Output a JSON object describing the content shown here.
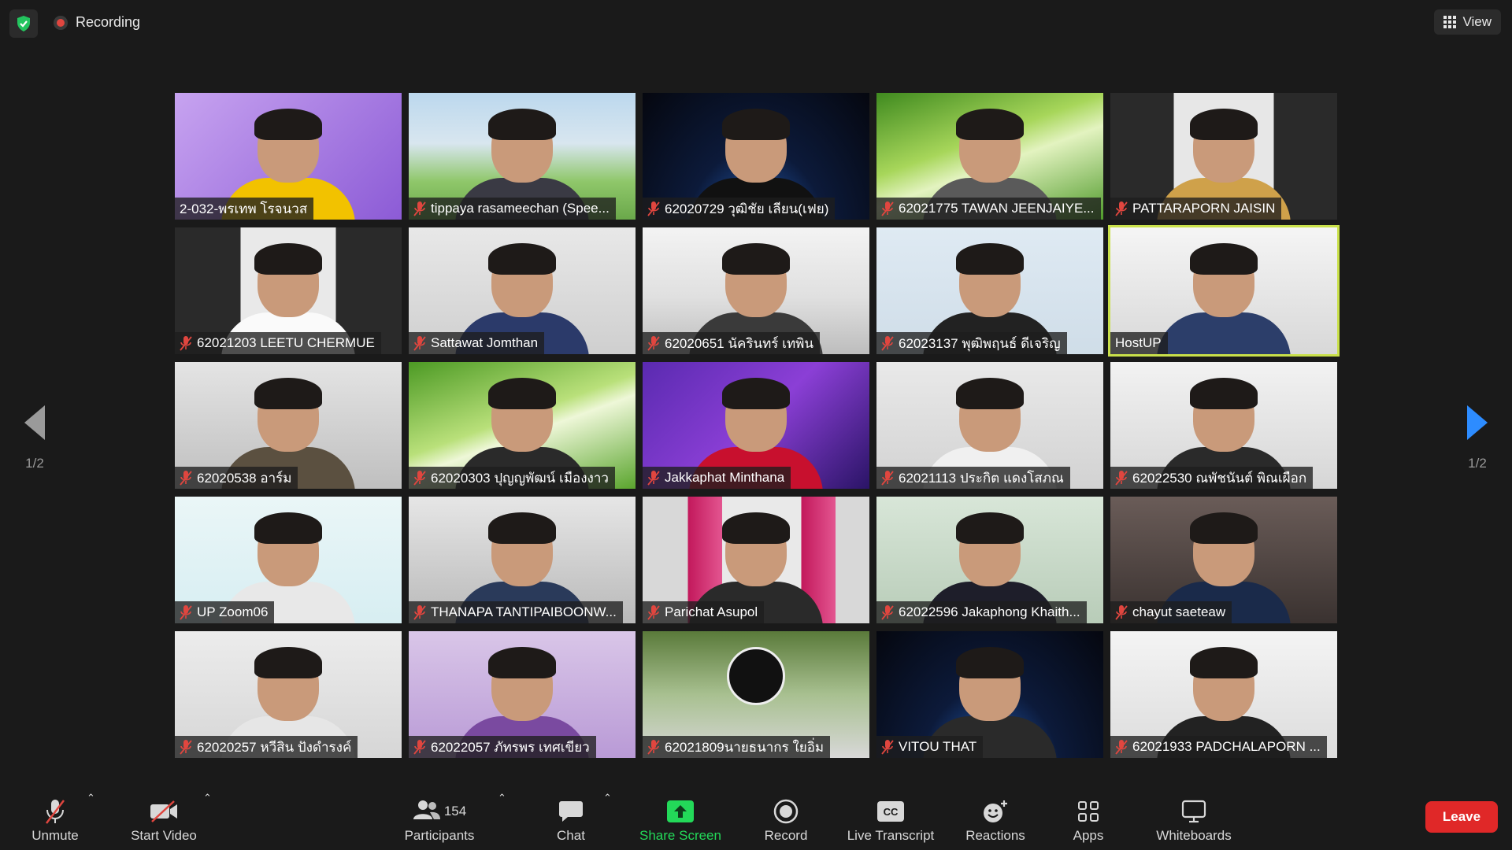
{
  "header": {
    "recording_label": "Recording",
    "view_label": "View"
  },
  "pager": {
    "left": "1/2",
    "right": "1/2"
  },
  "participants": [
    {
      "name": "2-032-พรเทพ โรจนวส",
      "muted": false
    },
    {
      "name": "tippaya rasameechan (Spee...",
      "muted": true
    },
    {
      "name": "62020729 วุฒิชัย เลียน(เฟย)",
      "muted": true
    },
    {
      "name": "62021775 TAWAN JEENJAIYE...",
      "muted": true
    },
    {
      "name": "PATTARAPORN JAISIN",
      "muted": true
    },
    {
      "name": "62021203 LEETU CHERMUE",
      "muted": true
    },
    {
      "name": "Sattawat Jomthan",
      "muted": true
    },
    {
      "name": "62020651 นัครินทร์ เทพิน",
      "muted": true
    },
    {
      "name": "62023137 พุฒิพฤนธ์ ดีเจริญ",
      "muted": true
    },
    {
      "name": "HostUP",
      "muted": false
    },
    {
      "name": "62020538 อาร์ม",
      "muted": true
    },
    {
      "name": "62020303 ปุญญพัฒน์ เมืองงาว",
      "muted": true
    },
    {
      "name": "Jakkaphat Minthana",
      "muted": true
    },
    {
      "name": "62021113 ประกิต แดงโสภณ",
      "muted": true
    },
    {
      "name": "62022530 ณพัชนันต์ พิณเผือก",
      "muted": true
    },
    {
      "name": "UP Zoom06",
      "muted": true
    },
    {
      "name": "THANAPA TANTIPAIBOONW...",
      "muted": true
    },
    {
      "name": "Parichat Asupol",
      "muted": true
    },
    {
      "name": "62022596 Jakaphong Khaith...",
      "muted": true
    },
    {
      "name": "chayut saeteaw",
      "muted": true
    },
    {
      "name": "62020257 หวีสิน ปังดำรงค์",
      "muted": true
    },
    {
      "name": "62022057 ภัทรพร เทศเขียว",
      "muted": true
    },
    {
      "name": "62021809นายธนากร ใยอิ่ม",
      "muted": true
    },
    {
      "name": "VITOU THAT",
      "muted": true
    },
    {
      "name": "62021933 PADCHALAPORN ...",
      "muted": true
    }
  ],
  "active_speaker_index": 9,
  "toolbar": {
    "unmute": "Unmute",
    "start_video": "Start Video",
    "participants": "Participants",
    "participants_count": "154",
    "chat": "Chat",
    "share_screen": "Share Screen",
    "record": "Record",
    "live_transcript": "Live Transcript",
    "reactions": "Reactions",
    "apps": "Apps",
    "whiteboards": "Whiteboards",
    "leave": "Leave"
  },
  "colors": {
    "accent_green": "#23d959",
    "leave_red": "#e02828",
    "active_outline": "#c9e04a",
    "nav_blue": "#2d8cff",
    "mute_red": "#e0463f"
  }
}
